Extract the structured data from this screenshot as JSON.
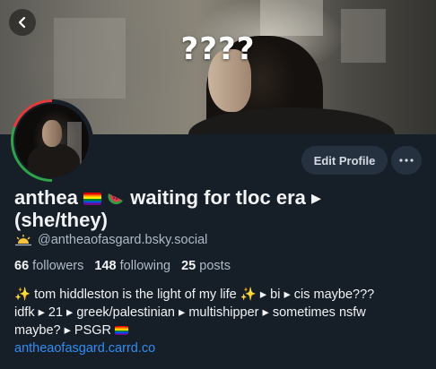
{
  "banner": {
    "overlay_text": "????"
  },
  "profile": {
    "display_name": "anthea 🏳️‍🌈 🍉 waiting for tloc era ▸ (she/they)",
    "name_part1": "anthea",
    "name_part2": "waiting for tloc era ▸",
    "name_part3": "(she/they)",
    "handle": "@antheaofasgard.bsky.social",
    "followers_count": "66",
    "followers_label": "followers",
    "following_count": "148",
    "following_label": "following",
    "posts_count": "25",
    "posts_label": "posts",
    "bio_line1": "✨ tom hiddleston is the light of my life ✨  ▸ bi ▸ cis maybe???",
    "bio_line2": "idfk ▸ 21 ▸ greek/palestinian ▸ multishipper ▸ sometimes nsfw",
    "bio_line3": "maybe? ▸ PSGR",
    "bio_link": "antheaofasgard.carrd.co"
  },
  "buttons": {
    "edit_profile": "Edit Profile"
  },
  "icons": {
    "back": "chevron-left-icon",
    "more": "ellipsis-icon",
    "handle_emoji": "sunrise-icon",
    "pride_flag": "rainbow-flag-icon",
    "watermelon": "watermelon-icon"
  },
  "colors": {
    "background": "#161e27",
    "button_bg": "#263140",
    "link": "#2f8ef4",
    "muted_text": "#aebbc9"
  }
}
